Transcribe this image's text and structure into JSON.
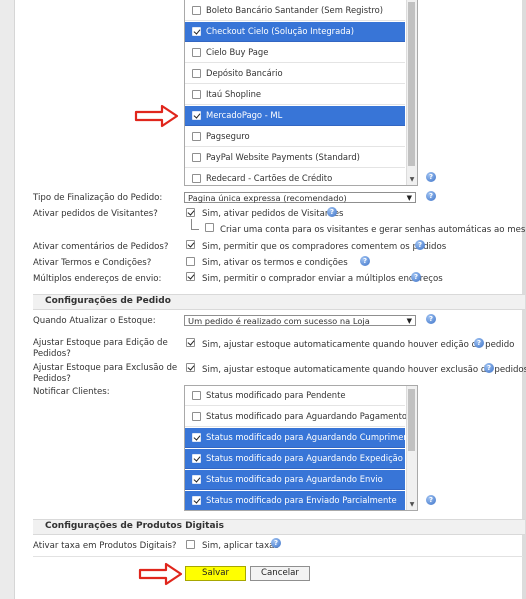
{
  "payment_list": {
    "options": [
      {
        "label": "Boleto Bancário Santander (Sem Registro)",
        "selected": false
      },
      {
        "label": "Checkout Cielo (Solução Integrada)",
        "selected": true
      },
      {
        "label": "Cielo Buy Page",
        "selected": false
      },
      {
        "label": "Depósito Bancário",
        "selected": false
      },
      {
        "label": "Itaú Shopline",
        "selected": false
      },
      {
        "label": "MercadoPago - ML",
        "selected": true
      },
      {
        "label": "Pagseguro",
        "selected": false
      },
      {
        "label": "PayPal Website Payments (Standard)",
        "selected": false
      },
      {
        "label": "Redecard - Cartões de Crédito",
        "selected": false
      }
    ]
  },
  "checkout": {
    "finalization_label": "Tipo de Finalização do Pedido:",
    "finalization_value": "Pagina única expressa (recomendado)",
    "guests_label": "Ativar pedidos de Visitantes?",
    "guests_check": "Sim, ativar pedidos de Visitantes",
    "guests_sub_check": "Criar uma conta para os visitantes e gerar senhas automáticas ao mesmo",
    "comments_label": "Ativar comentários de Pedidos?",
    "comments_check": "Sim, permitir que os compradores comentem os pedidos",
    "terms_label": "Ativar Termos e Condições?",
    "terms_check": "Sim, ativar os termos e condições",
    "multi_address_label": "Múltiplos endereços de envio:",
    "multi_address_check": "Sim, permitir o comprador enviar a múltiplos endereços"
  },
  "order_settings": {
    "title": "Configurações de Pedido",
    "stock_update_label": "Quando Atualizar o Estoque:",
    "stock_update_value": "Um pedido é realizado com sucesso na Loja",
    "adjust_edit_label_1": "Ajustar Estoque para Edição de",
    "adjust_edit_label_2": "Pedidos?",
    "adjust_edit_check": "Sim, ajustar estoque automaticamente quando houver edição de pedido",
    "adjust_delete_label_1": "Ajustar Estoque para Exclusão de",
    "adjust_delete_label_2": "Pedidos?",
    "adjust_delete_check": "Sim, ajustar estoque automaticamente quando houver exclusão de pedidos",
    "notify_label": "Notificar Clientes:",
    "notify_options": [
      {
        "label": "Status modificado para Pendente",
        "selected": false
      },
      {
        "label": "Status modificado para Aguardando Pagamento",
        "selected": false
      },
      {
        "label": "Status modificado para Aguardando Cumprimento",
        "selected": true
      },
      {
        "label": "Status modificado para Aguardando Expedição",
        "selected": true
      },
      {
        "label": "Status modificado para Aguardando Envio",
        "selected": true
      },
      {
        "label": "Status modificado para Enviado Parcialmente",
        "selected": true
      }
    ]
  },
  "digital_products": {
    "title": "Configurações de Produtos Digitais",
    "fee_label": "Ativar taxa em Produtos Digitais?",
    "fee_check": "Sim, aplicar taxas"
  },
  "actions": {
    "save_label": "Salvar",
    "cancel_label": "Cancelar"
  },
  "colors": {
    "selection": "#3875d7",
    "arrow": "#e0261c",
    "save_button": "#ffff00"
  },
  "icons": {
    "help": "help-icon",
    "arrow": "red-arrow-icon"
  }
}
